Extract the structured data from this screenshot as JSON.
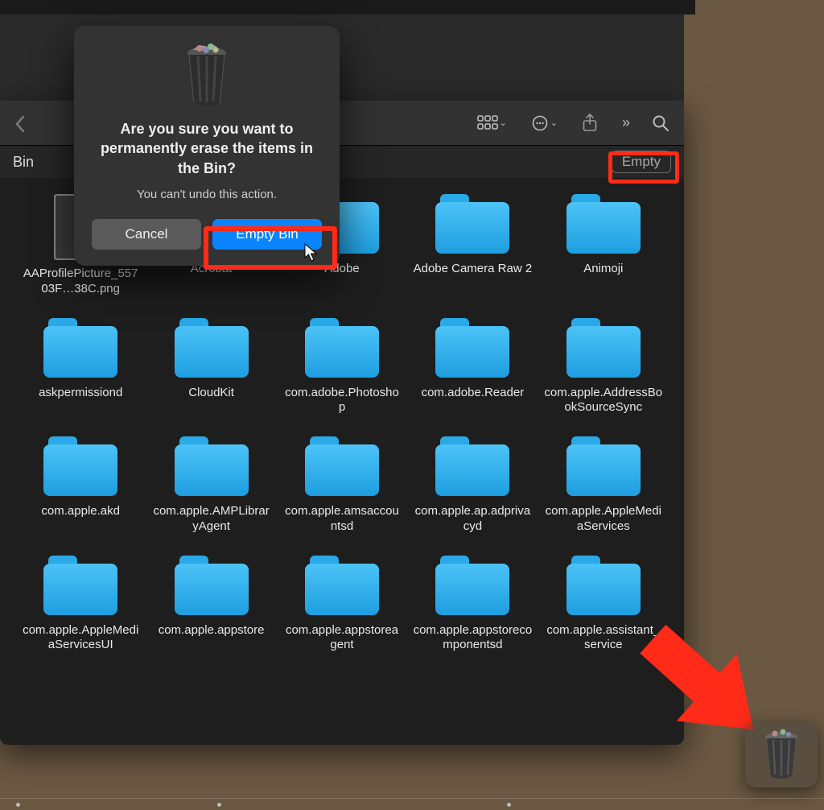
{
  "window": {
    "location_label": "Bin",
    "empty_button": "Empty"
  },
  "dialog": {
    "title": "Are you sure you want to permanently erase the items in the Bin?",
    "message": "You can't undo this action.",
    "cancel": "Cancel",
    "confirm": "Empty Bin"
  },
  "items": [
    {
      "name": "AAProfilePicture_55703F…38C.png",
      "type": "file"
    },
    {
      "name": "Acrobat",
      "type": "folder"
    },
    {
      "name": "Adobe",
      "type": "folder"
    },
    {
      "name": "Adobe Camera Raw 2",
      "type": "folder"
    },
    {
      "name": "Animoji",
      "type": "folder"
    },
    {
      "name": "askpermissiond",
      "type": "folder"
    },
    {
      "name": "CloudKit",
      "type": "folder"
    },
    {
      "name": "com.adobe.Photoshop",
      "type": "folder"
    },
    {
      "name": "com.adobe.Reader",
      "type": "folder"
    },
    {
      "name": "com.apple.AddressBookSourceSync",
      "type": "folder"
    },
    {
      "name": "com.apple.akd",
      "type": "folder"
    },
    {
      "name": "com.apple.AMPLibraryAgent",
      "type": "folder"
    },
    {
      "name": "com.apple.amsaccountsd",
      "type": "folder"
    },
    {
      "name": "com.apple.ap.adprivacyd",
      "type": "folder"
    },
    {
      "name": "com.apple.AppleMediaServices",
      "type": "folder"
    },
    {
      "name": "com.apple.AppleMediaServicesUI",
      "type": "folder"
    },
    {
      "name": "com.apple.appstore",
      "type": "folder"
    },
    {
      "name": "com.apple.appstoreagent",
      "type": "folder"
    },
    {
      "name": "com.apple.appstorecomponentsd",
      "type": "folder"
    },
    {
      "name": "com.apple.assistant_service",
      "type": "folder"
    }
  ],
  "icons": {
    "back": "chevron-left-icon",
    "view": "icon-view-icon",
    "group": "group-by-icon",
    "share": "share-icon",
    "more": "double-chevron-right-icon",
    "search": "search-icon",
    "trash": "trash-full-icon",
    "dock_trash": "trash-full-icon"
  }
}
